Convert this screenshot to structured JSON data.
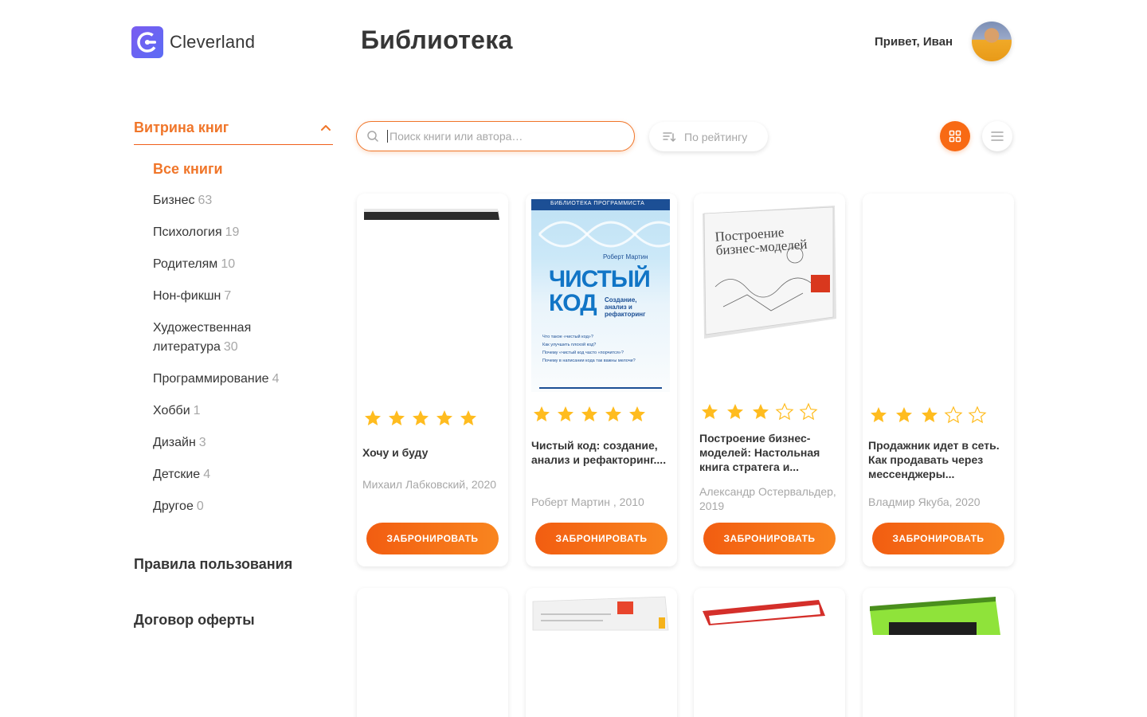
{
  "brand": {
    "name": "Cleverland",
    "accent": "#f0762a"
  },
  "header": {
    "title": "Библиотека",
    "greeting": "Привет, Иван"
  },
  "sidebar": {
    "showcase_title": "Витрина книг",
    "categories": [
      {
        "label": "Все книги",
        "count": "",
        "active": true
      },
      {
        "label": "Бизнес",
        "count": "63"
      },
      {
        "label": "Психология",
        "count": "19"
      },
      {
        "label": "Родителям",
        "count": "10"
      },
      {
        "label": "Нон-фикшн",
        "count": "7"
      },
      {
        "label": "Художественная литература",
        "count": "30"
      },
      {
        "label": "Программирование",
        "count": "4"
      },
      {
        "label": "Хобби",
        "count": "1"
      },
      {
        "label": "Дизайн",
        "count": "3"
      },
      {
        "label": "Детские",
        "count": "4"
      },
      {
        "label": "Другое",
        "count": "0"
      }
    ],
    "rules_link": "Правила пользования",
    "offer_link": "Договор оферты"
  },
  "toolbar": {
    "search_placeholder": "Поиск книги или автора…",
    "sort_label": "По рейтингу",
    "view_mode": "grid"
  },
  "books": [
    {
      "title": "Хочу и буду",
      "meta": "Михаил Лабковский, 2020",
      "rating": 5,
      "button": "ЗАБРОНИРОВАТЬ"
    },
    {
      "title": "Чистый код: создание, анализ и рефакторинг....",
      "meta": "Роберт Мартин , 2010",
      "rating": 5,
      "button": "ЗАБРОНИРОВАТЬ",
      "cover_text": {
        "series": "БИБЛИОТЕКА ПРОГРАММИСТА",
        "author": "Роберт Мартин",
        "line1": "ЧИСТЫЙ",
        "line2": "КОД",
        "subtitle": "Создание, анализ и рефакторинг",
        "questions": [
          "Что такое «чистый код»?",
          "Как улучшить плохой код?",
          "Почему «чистый код часто «порчится»?",
          "Почему в написании кода так важны мелочи?"
        ]
      }
    },
    {
      "title": "Построение бизнес-моделей: Настольная книга стратега и...",
      "meta": "Александр Остервальдер, 2019",
      "rating": 3,
      "button": "ЗАБРОНИРОВАТЬ",
      "cover_text": {
        "title": "Построение бизнес-моделей"
      }
    },
    {
      "title": "Продажник идет в сеть. Как продавать через мессенджеры...",
      "meta": "Владмир Якуба, 2020",
      "rating": 3,
      "button": "ЗАБРОНИРОВАТЬ"
    }
  ],
  "icons": [
    "logo-icon",
    "chevron-up-icon",
    "search-icon",
    "sort-icon",
    "grid-icon",
    "list-icon",
    "star-icon"
  ]
}
